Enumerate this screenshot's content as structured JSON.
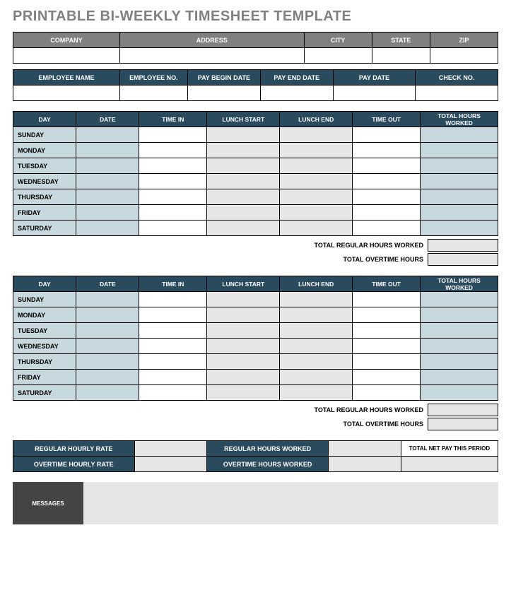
{
  "title": "PRINTABLE BI-WEEKLY TIMESHEET TEMPLATE",
  "company_table": {
    "headers": [
      "COMPANY",
      "ADDRESS",
      "CITY",
      "STATE",
      "ZIP"
    ],
    "values": [
      "",
      "",
      "",
      "",
      ""
    ]
  },
  "employee_table": {
    "headers": [
      "EMPLOYEE NAME",
      "EMPLOYEE NO.",
      "PAY BEGIN DATE",
      "PAY END DATE",
      "PAY DATE",
      "CHECK NO."
    ],
    "values": [
      "",
      "",
      "",
      "",
      "",
      ""
    ]
  },
  "week_headers": [
    "DAY",
    "DATE",
    "TIME IN",
    "LUNCH START",
    "LUNCH END",
    "TIME OUT",
    "TOTAL HOURS WORKED"
  ],
  "week1": {
    "days": [
      "SUNDAY",
      "MONDAY",
      "TUESDAY",
      "WEDNESDAY",
      "THURSDAY",
      "FRIDAY",
      "SATURDAY"
    ],
    "summary": {
      "regular_label": "TOTAL REGULAR HOURS WORKED",
      "regular_value": "",
      "overtime_label": "TOTAL OVERTIME HOURS",
      "overtime_value": ""
    }
  },
  "week2": {
    "days": [
      "SUNDAY",
      "MONDAY",
      "TUESDAY",
      "WEDNESDAY",
      "THURSDAY",
      "FRIDAY",
      "SATURDAY"
    ],
    "summary": {
      "regular_label": "TOTAL REGULAR HOURS WORKED",
      "regular_value": "",
      "overtime_label": "TOTAL OVERTIME HOURS",
      "overtime_value": ""
    }
  },
  "pay": {
    "reg_rate_label": "REGULAR HOURLY RATE",
    "reg_rate_value": "",
    "reg_hours_label": "REGULAR HOURS WORKED",
    "reg_hours_value": "",
    "ot_rate_label": "OVERTIME HOURLY RATE",
    "ot_rate_value": "",
    "ot_hours_label": "OVERTIME HOURS WORKED",
    "ot_hours_value": "",
    "net_label": "TOTAL NET PAY THIS PERIOD",
    "net_value": ""
  },
  "messages": {
    "label": "MESSAGES",
    "value": ""
  }
}
